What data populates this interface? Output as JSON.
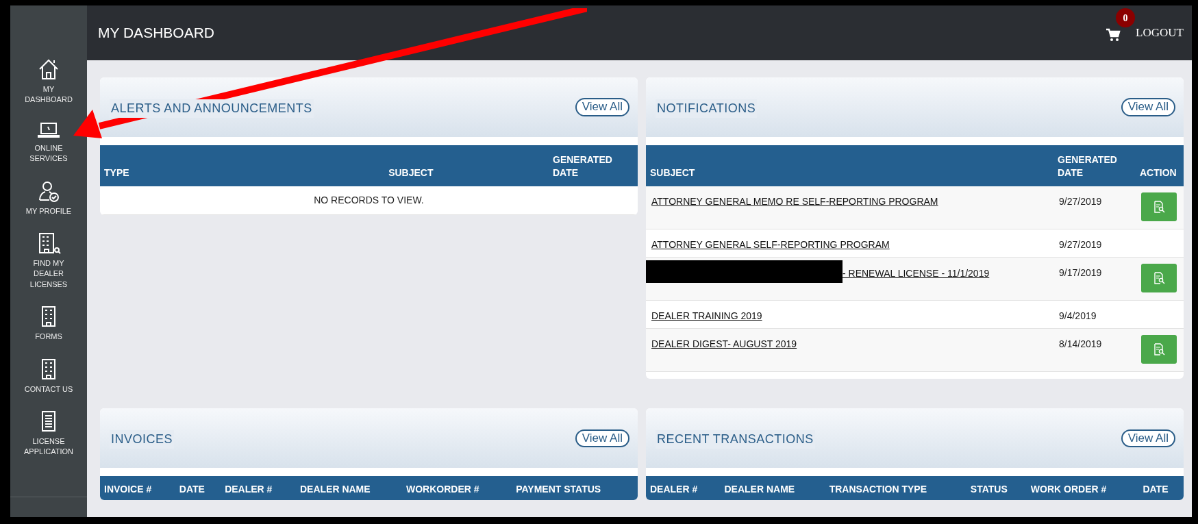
{
  "sidebar": {
    "items": [
      {
        "label": "MY DASHBOARD"
      },
      {
        "label": "ONLINE SERVICES"
      },
      {
        "label": "MY PROFILE"
      },
      {
        "label": "FIND MY DEALER LICENSES"
      },
      {
        "label": "FORMS"
      },
      {
        "label": "CONTACT US"
      },
      {
        "label": "LICENSE APPLICATION"
      }
    ]
  },
  "header": {
    "title": "MY DASHBOARD",
    "cart_count": "0",
    "logout": "LOGOUT"
  },
  "panels": [
    {
      "title": "ALERTS AND ANNOUNCEMENTS",
      "button": "View All",
      "columns": [
        "TYPE",
        "SUBJECT",
        "GENERATED DATE"
      ],
      "empty_text": "NO RECORDS TO VIEW."
    },
    {
      "title": "NOTIFICATIONS",
      "button": "View All",
      "columns": [
        "SUBJECT",
        "GENERATED DATE",
        "ACTION"
      ],
      "rows": [
        {
          "subject": "ATTORNEY GENERAL MEMO RE SELF-REPORTING PROGRAM",
          "date": "9/27/2019",
          "action": true,
          "redacted": false
        },
        {
          "subject": "ATTORNEY GENERAL SELF-REPORTING PROGRAM",
          "date": "9/27/2019",
          "action": false,
          "redacted": false
        },
        {
          "subject": "- RENEWAL LICENSE - 11/1/2019",
          "date": "9/17/2019",
          "action": true,
          "redacted": true
        },
        {
          "subject": "DEALER TRAINING 2019",
          "date": "9/4/2019",
          "action": false,
          "redacted": false
        },
        {
          "subject": "DEALER DIGEST- AUGUST 2019",
          "date": "8/14/2019",
          "action": true,
          "redacted": false
        }
      ]
    },
    {
      "title": "INVOICES",
      "button": "View All",
      "columns": [
        "INVOICE #",
        "DATE",
        "DEALER #",
        "DEALER NAME",
        "WORKORDER #",
        "PAYMENT STATUS"
      ]
    },
    {
      "title": "RECENT TRANSACTIONS",
      "button": "View All",
      "columns": [
        "DEALER #",
        "DEALER NAME",
        "TRANSACTION TYPE",
        "STATUS",
        "WORK ORDER #",
        "DATE"
      ]
    }
  ]
}
